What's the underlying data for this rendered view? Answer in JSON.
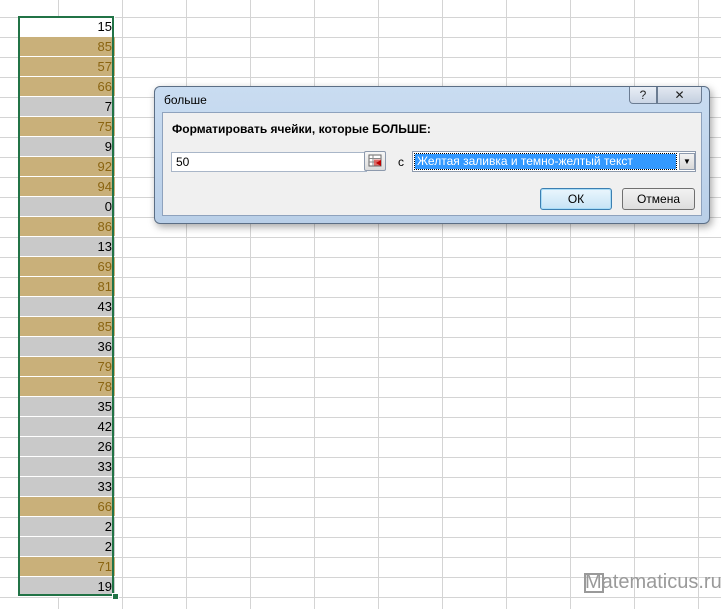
{
  "column_values": [
    {
      "value": "15",
      "style": "plain"
    },
    {
      "value": "85",
      "style": "hi"
    },
    {
      "value": "57",
      "style": "hi"
    },
    {
      "value": "66",
      "style": "hi"
    },
    {
      "value": "7",
      "style": "lo"
    },
    {
      "value": "75",
      "style": "hi"
    },
    {
      "value": "9",
      "style": "lo"
    },
    {
      "value": "92",
      "style": "hi"
    },
    {
      "value": "94",
      "style": "hi"
    },
    {
      "value": "0",
      "style": "lo"
    },
    {
      "value": "86",
      "style": "hi"
    },
    {
      "value": "13",
      "style": "lo"
    },
    {
      "value": "69",
      "style": "hi"
    },
    {
      "value": "81",
      "style": "hi"
    },
    {
      "value": "43",
      "style": "lo"
    },
    {
      "value": "85",
      "style": "hi"
    },
    {
      "value": "36",
      "style": "lo"
    },
    {
      "value": "79",
      "style": "hi"
    },
    {
      "value": "78",
      "style": "hi"
    },
    {
      "value": "35",
      "style": "lo"
    },
    {
      "value": "42",
      "style": "lo"
    },
    {
      "value": "26",
      "style": "lo"
    },
    {
      "value": "33",
      "style": "lo"
    },
    {
      "value": "33",
      "style": "lo"
    },
    {
      "value": "66",
      "style": "hi"
    },
    {
      "value": "2",
      "style": "lo"
    },
    {
      "value": "2",
      "style": "lo"
    },
    {
      "value": "71",
      "style": "hi"
    },
    {
      "value": "19",
      "style": "lo"
    }
  ],
  "colors": {
    "highlight_fill": "#c9b07a",
    "highlight_text": "#8a6410",
    "selection_border": "#217346"
  },
  "dialog": {
    "title": "больше",
    "help_label": "?",
    "close_label": "✕",
    "prompt": "Форматировать ячейки, которые БОЛЬШЕ:",
    "value": "50",
    "with_label": "с",
    "format_option": "Желтая заливка и темно-желтый текст",
    "ok_label": "ОК",
    "cancel_label": "Отмена"
  },
  "watermark": "Matematicus.ru",
  "icons": {
    "collapse": "range-select-icon",
    "dropdown": "chevron-down-icon"
  }
}
